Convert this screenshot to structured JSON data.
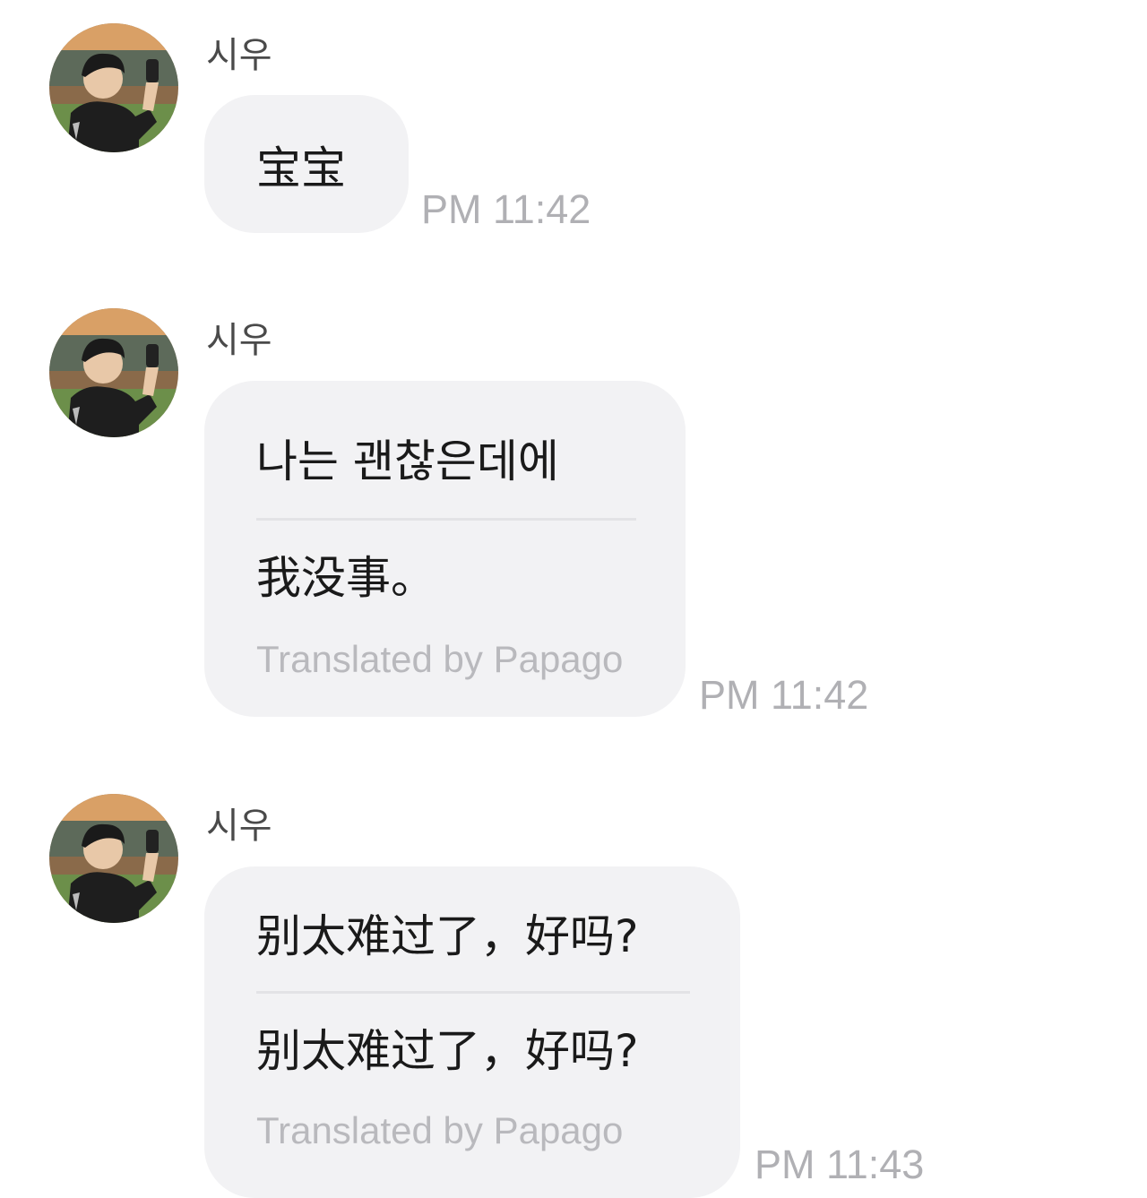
{
  "messages": [
    {
      "sender": "시우",
      "original": "宝宝",
      "time": "PM 11:42"
    },
    {
      "sender": "시우",
      "original": "나는 괜찮은데에",
      "translation": "我没事。",
      "translated_by": "Translated by Papago",
      "time": "PM 11:42"
    },
    {
      "sender": "시우",
      "original": "别太难过了，好吗?",
      "translation": "别太难过了，好吗?",
      "translated_by": "Translated by Papago",
      "time": "PM 11:43"
    }
  ]
}
